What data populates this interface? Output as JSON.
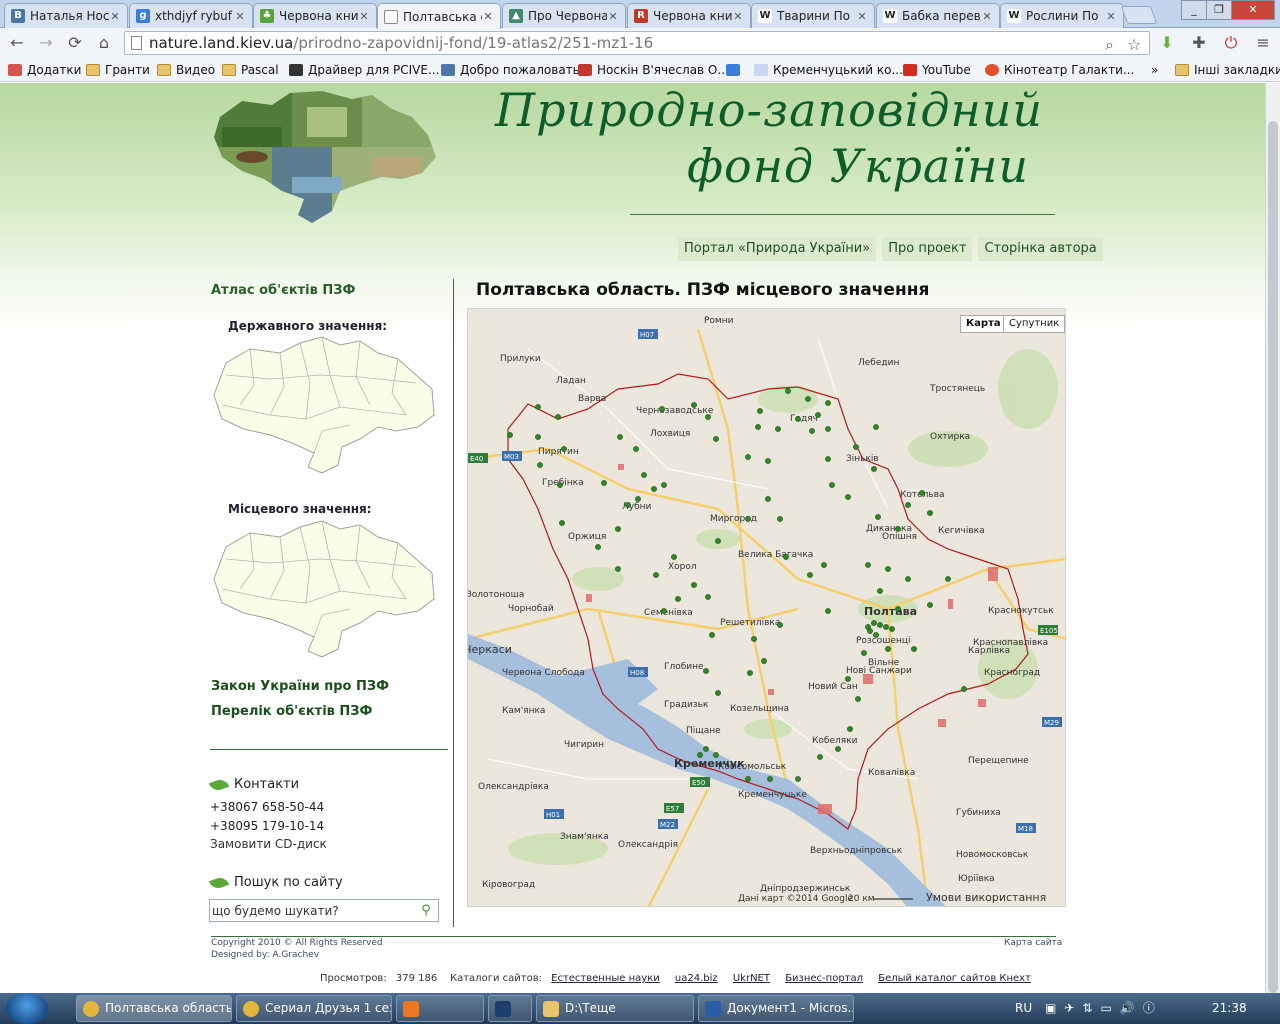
{
  "browser": {
    "tabs": [
      {
        "title": "Наталья Нос",
        "favicon": "vk-icon",
        "color": "#4a76a8",
        "glyph": "В"
      },
      {
        "title": "xthdjyf rybuf",
        "favicon": "google-icon",
        "color": "#3b7ddd",
        "glyph": "g"
      },
      {
        "title": "Червона кни",
        "favicon": "leaf-icon",
        "color": "#58a33a",
        "glyph": "♣"
      },
      {
        "title": "Полтавська о",
        "favicon": "page-icon",
        "color": "#ffffff",
        "glyph": ""
      },
      {
        "title": "Про Червона",
        "favicon": "site-icon",
        "color": "#3f8a6b",
        "glyph": "▲"
      },
      {
        "title": "Червона кни",
        "favicon": "red-book-icon",
        "color": "#c0392b",
        "glyph": "R"
      },
      {
        "title": "Тварини По",
        "favicon": "wikipedia-icon",
        "color": "#ffffff",
        "glyph": "W"
      },
      {
        "title": "Бабка перев",
        "favicon": "wikipedia-icon",
        "color": "#ffffff",
        "glyph": "W"
      },
      {
        "title": "Рослини По",
        "favicon": "wikipedia-icon",
        "color": "#ffffff",
        "glyph": "W"
      }
    ],
    "active_tab": 3,
    "url_host": "nature.land.kiev.ua",
    "url_path": "/prirodno-zapovidnij-fond/19-atlas2/251-mz1-16",
    "bookmarks": [
      {
        "label": "Додатки",
        "icon": "apps-icon"
      },
      {
        "label": "Гранти",
        "icon": "folder-icon"
      },
      {
        "label": "Видео",
        "icon": "folder-icon"
      },
      {
        "label": "Pascal",
        "icon": "folder-icon"
      },
      {
        "label": "Драйвер для PCIVE...",
        "icon": "monitor-icon"
      },
      {
        "label": "Добро пожаловать",
        "icon": "vk-icon"
      },
      {
        "label": "Носкін В'ячеслав О...",
        "icon": "red-book-icon"
      },
      {
        "label": "",
        "icon": "google-icon"
      },
      {
        "label": "Кременчуцький ко...",
        "icon": "cloud-icon"
      },
      {
        "label": "YouTube",
        "icon": "youtube-icon"
      },
      {
        "label": "Кінотеатр Галакти...",
        "icon": "star-icon"
      },
      {
        "label": "»",
        "icon": ""
      },
      {
        "label": "Інші закладки",
        "icon": "folder-icon"
      }
    ]
  },
  "site": {
    "title_line1": "Природно-заповідний",
    "title_line2": "фонд України",
    "nav": [
      "Портал «Природа України»",
      "Про проект",
      "Сторінка автора"
    ]
  },
  "sidebar": {
    "title": "Атлас об'єктів ПЗФ",
    "state_label": "Державного значення:",
    "local_label": "Місцевого значення:",
    "link_law": "Закон України про ПЗФ",
    "link_list": "Перелік об'єктів ПЗФ",
    "contacts_heading": "Контакти",
    "phone1": "+38067 658-50-44",
    "phone2": "+38095 179-10-14",
    "order_cd": "Замовити CD-диск",
    "search_heading": "Пошук по сайту",
    "search_placeholder": "що будемо шукати?"
  },
  "main": {
    "title": "Полтавська область. ПЗФ місцевого значення",
    "map_type_map": "Карта",
    "map_type_sat": "Супутник",
    "map_data": "Дані карт ©2014 Google",
    "map_scale": "20 км",
    "map_terms": "Умови використання",
    "places": [
      "Ромни",
      "Прилуки",
      "Ладан",
      "Варва",
      "Чернозаводське",
      "Лохвиця",
      "Гадяч",
      "Лебедин",
      "Тростянець",
      "Охтирка",
      "Зіньків",
      "Пирятин",
      "Гребінка",
      "Лубни",
      "Миргород",
      "Котельва",
      "Опішня",
      "Диканька",
      "Велика Багачка",
      "Хорол",
      "Оржиця",
      "Семенівка",
      "Решетилівка",
      "Полтава",
      "Розсошенці",
      "Карлівка",
      "Нові Санжари",
      "Глобине",
      "Градизьк",
      "Козельщина",
      "Кобеляки",
      "Красноград",
      "Кременчук",
      "Комсомольськ",
      "Піщане",
      "Золотоноша",
      "Чорнобай",
      "Черкаси",
      "Червона Слобода",
      "Чигирин",
      "Олександрівка",
      "Знам'янка",
      "Олександрія",
      "Верхньодніпровськ",
      "Кіровоград",
      "Дніпродзержинськ",
      "Новомосковськ",
      "Губиниха",
      "Перещепине",
      "Краснопавлівка",
      "Юріївка",
      "Кегичівка",
      "Краснокутськ",
      "Новий Сан",
      "Вільне",
      "Кременчуцьке",
      "Ковалівка",
      "Кам'янка"
    ],
    "roads": [
      "H07",
      "M03",
      "E40",
      "H08",
      "E57",
      "M22",
      "H01",
      "E50",
      "M18",
      "M29",
      "E105"
    ]
  },
  "footer": {
    "copyright": "Copyright 2010 © All Rights Reserved",
    "designed": "Designed by: A.Grachev",
    "sitemap": "Карта сайта",
    "views_label": "Просмотров:",
    "views_value": "379 186",
    "catalogs_label": "Каталоги сайтов:",
    "catalogs": [
      "Естественные науки",
      "ua24.biz",
      "UkrNET",
      "Бизнес-портал",
      "Белый каталог сайтов Кнехт"
    ]
  },
  "taskbar": {
    "tasks": [
      {
        "label": "Полтавська область...",
        "icon": "chrome-icon",
        "active": true
      },
      {
        "label": "Сериал Друзья 1 сез...",
        "icon": "chrome-icon",
        "active": false
      },
      {
        "label": "",
        "icon": "media-player-icon",
        "active": false
      },
      {
        "label": "",
        "icon": "photoshop-icon",
        "active": false
      },
      {
        "label": "D:\\Теще",
        "icon": "folder-icon",
        "active": false
      },
      {
        "label": "Документ1 - Micros...",
        "icon": "word-icon",
        "active": false
      }
    ],
    "language": "RU",
    "time": "21:38"
  }
}
